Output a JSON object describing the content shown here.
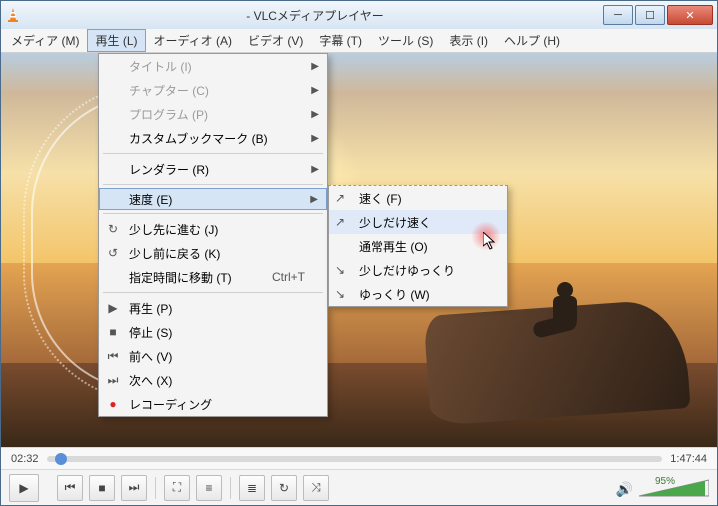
{
  "title": "- VLCメディアプレイヤー",
  "menubar": {
    "items": [
      "メディア (M)",
      "再生 (L)",
      "オーディオ (A)",
      "ビデオ (V)",
      "字幕 (T)",
      "ツール (S)",
      "表示 (I)",
      "ヘルプ (H)"
    ],
    "active_index": 1
  },
  "playback_menu": {
    "items": [
      {
        "label": "タイトル (I)",
        "icon": "",
        "disabled": true,
        "submenu": true
      },
      {
        "label": "チャプター (C)",
        "icon": "",
        "disabled": true,
        "submenu": true
      },
      {
        "label": "プログラム (P)",
        "icon": "",
        "disabled": true,
        "submenu": true
      },
      {
        "label": "カスタムブックマーク (B)",
        "icon": "",
        "disabled": false,
        "submenu": true
      },
      {
        "sep": true
      },
      {
        "label": "レンダラー (R)",
        "icon": "",
        "disabled": false,
        "submenu": true
      },
      {
        "sep": true
      },
      {
        "label": "速度 (E)",
        "icon": "",
        "disabled": false,
        "submenu": true,
        "active": true
      },
      {
        "sep": true
      },
      {
        "label": "少し先に進む (J)",
        "icon": "↻",
        "disabled": false,
        "submenu": false
      },
      {
        "label": "少し前に戻る (K)",
        "icon": "↺",
        "disabled": false,
        "submenu": false
      },
      {
        "label": "指定時間に移動 (T)",
        "icon": "",
        "disabled": false,
        "submenu": false,
        "shortcut": "Ctrl+T"
      },
      {
        "sep": true
      },
      {
        "label": "再生 (P)",
        "icon": "▶",
        "disabled": false,
        "submenu": false
      },
      {
        "label": "停止 (S)",
        "icon": "■",
        "disabled": false,
        "submenu": false
      },
      {
        "label": "前へ (V)",
        "icon": "⏮",
        "disabled": false,
        "submenu": false
      },
      {
        "label": "次へ (X)",
        "icon": "⏭",
        "disabled": false,
        "submenu": false
      },
      {
        "label": "レコーディング",
        "icon": "●",
        "disabled": false,
        "submenu": false,
        "icon_color": "#d22"
      }
    ]
  },
  "speed_menu": {
    "items": [
      {
        "label": "速く (F)",
        "curve": "↗"
      },
      {
        "label": "少しだけ速く",
        "curve": "↗",
        "highlight": true
      },
      {
        "label": "通常再生 (O)",
        "curve": ""
      },
      {
        "label": "少しだけゆっくり",
        "curve": "↘"
      },
      {
        "label": "ゆっくり (W)",
        "curve": "↘"
      }
    ]
  },
  "time": {
    "current": "02:32",
    "total": "1:47:44"
  },
  "volume": {
    "percent_label": "95%"
  }
}
